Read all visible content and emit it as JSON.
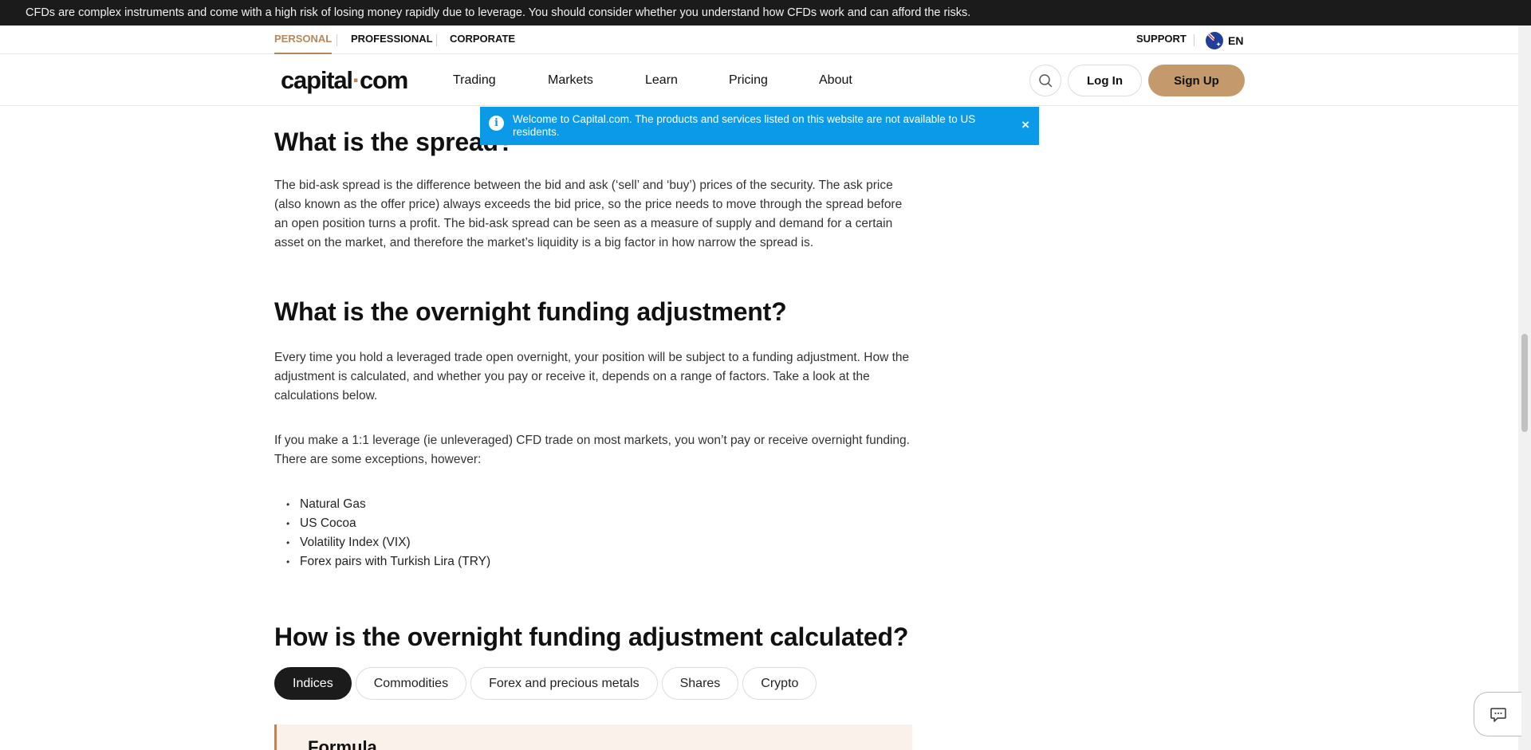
{
  "risk_banner": "CFDs are complex instruments and come with a high risk of losing money rapidly due to leverage. You should consider whether you understand how CFDs work and can afford the risks.",
  "segments": {
    "personal": "PERSONAL",
    "professional": "PROFESSIONAL",
    "corporate": "CORPORATE",
    "active": "PERSONAL"
  },
  "support_link": "SUPPORT",
  "language": "EN",
  "logo": {
    "part1": "capital",
    "dot": "·",
    "part2": "com"
  },
  "nav": {
    "trading": "Trading",
    "markets": "Markets",
    "learn": "Learn",
    "pricing": "Pricing",
    "about": "About"
  },
  "buttons": {
    "login": "Log In",
    "signup": "Sign Up"
  },
  "notice": {
    "text": "Welcome to Capital.com. The products and services listed on this website are not available to US residents.",
    "close": "×"
  },
  "sections": {
    "spread_heading": "What is the spread?",
    "spread_text": "The bid-ask spread is the difference between the bid and ask (‘sell’ and ‘buy’) prices of the security. The ask price (also known as the offer price) always exceeds the bid price, so the price needs to move through the spread before an open position turns a profit. The bid-ask spread can be seen as a measure of supply and demand for a certain asset on the market, and therefore the market’s liquidity is a big factor in how narrow the spread is.",
    "funding_heading": "What is the overnight funding adjustment?",
    "funding_text1": "Every time you hold a leveraged trade open overnight, your position will be subject to a funding adjustment. How the adjustment is calculated, and whether you pay or receive it, depends on a range of factors. Take a look at the calculations below.",
    "funding_text2": "If you make a 1:1 leverage (ie unleveraged) CFD trade on most markets, you won’t pay or receive overnight funding. There are some exceptions, however:",
    "exceptions": [
      "Natural Gas",
      "US Cocoa",
      "Volatility Index (VIX)",
      "Forex pairs with Turkish Lira (TRY)"
    ],
    "calc_heading": "How is the overnight funding adjustment calculated?"
  },
  "calc_tabs": [
    "Indices",
    "Commodities",
    "Forex and precious metals",
    "Shares",
    "Crypto"
  ],
  "active_calc_tab": "Indices",
  "formula_title": "Formula",
  "colors": {
    "accent": "#b8865a",
    "notice_blue": "#0b9ae8",
    "dark": "#1b1b1b",
    "signup_bg": "#c49a6c",
    "formula_bg": "#faf1ea"
  },
  "icons": {
    "search": "search-icon",
    "info": "info-icon",
    "close": "close-icon",
    "flag": "australia-flag-icon",
    "chat": "chat-icon"
  }
}
